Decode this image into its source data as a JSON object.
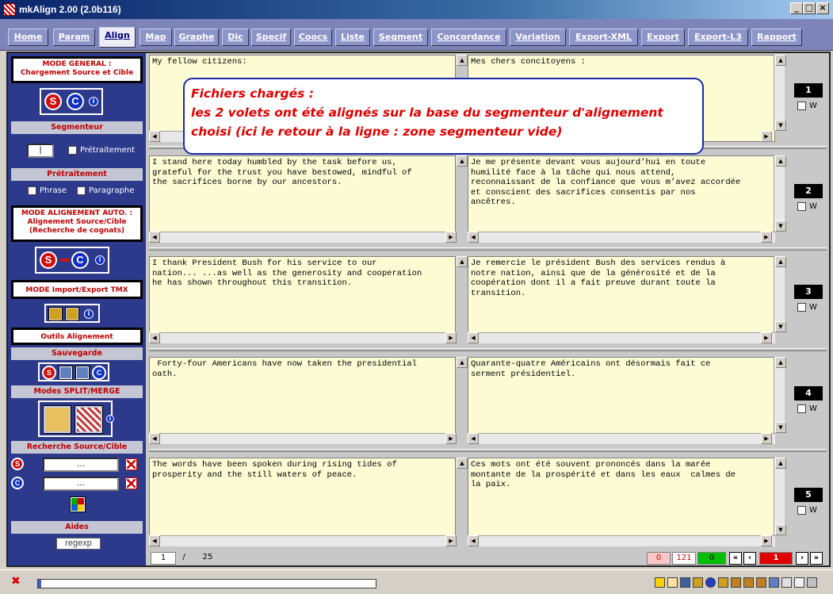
{
  "window": {
    "title": "mkAlign 2.00 (2.0b116)",
    "minimize": "_",
    "maximize": "□",
    "close": "×"
  },
  "tabs": [
    "Home",
    "Param",
    "Align",
    "Map",
    "Graphe",
    "Dic",
    "Specif",
    "Coocs",
    "Liste",
    "Segment",
    "Concordance",
    "Variation",
    "Export-XML",
    "Export",
    "Export-L3",
    "Rapport"
  ],
  "active_tab": "Align",
  "sidebar": {
    "mode_general": "MODE GENERAL :\nChargement Source et Cible",
    "segmenteur_label": "Segmenteur",
    "segmenteur_value": "|",
    "pretraitement_check": "Prétraitement",
    "pretraitement_label": "Prétraitement",
    "phrase_check": "Phrase",
    "paragraphe_check": "Paragraphe",
    "mode_alignement": "MODE ALIGNEMENT AUTO. :\nAlignement Source/Cible\n(Recherche de cognats)",
    "mode_tmx": "MODE Import/Export TMX",
    "outils": "Outils Alignement",
    "sauvegarde_label": "Sauvegarde",
    "modes_split_label": "Modes SPLIT/MERGE",
    "recherche_label": "Recherche Source/Cible",
    "search_source_value": "...",
    "search_target_value": "...",
    "aides_label": "Aides",
    "regexp_button": "regexp",
    "source_letter": "S",
    "cible_letter": "C",
    "info_letter": "i"
  },
  "callout": {
    "line1": "Fichiers chargés :",
    "line2": "les 2 volets ont été alignés sur la base du segmenteur d'alignement",
    "line3": "choisi (ici le retour à la ligne : zone segmenteur vide)"
  },
  "rows": [
    {
      "num": "1",
      "w_label": "W",
      "source": "My fellow citizens:",
      "target": "Mes chers concitoyens :"
    },
    {
      "num": "2",
      "w_label": "W",
      "source": "I stand here today humbled by the task before us,\ngrateful for the trust you have bestowed, mindful of\nthe sacrifices borne by our ancestors.",
      "target": "Je me présente devant vous aujourd’hui en toute\nhumilité face à la tâche qui nous attend,\nreconnaissant de la confiance que vous m’avez accordée\net conscient des sacrifices consentis par nos\nancêtres."
    },
    {
      "num": "3",
      "w_label": "W",
      "source": "I thank President Bush for his service to our\nnation... ...as well as the generosity and cooperation\nhe has shown throughout this transition.",
      "target": "Je remercie le président Bush des services rendus à\nnotre nation, ainsi que de la générosité et de la\ncoopération dont il a fait preuve durant toute la\ntransition."
    },
    {
      "num": "4",
      "w_label": "W",
      "source": " Forty-four Americans have now taken the presidential\noath.",
      "target": "Quarante-quatre Américains ont désormais fait ce\nserment présidentiel."
    },
    {
      "num": "5",
      "w_label": "W",
      "source": "The words have been spoken during rising tides of\nprosperity and the still waters of peace.",
      "target": "Ces mots ont été souvent prononcés dans la marée\nmontante de la prospérité et dans les eaux  calmes de\nla paix."
    }
  ],
  "pager": {
    "page": "1",
    "separator": "/",
    "total": "25",
    "count_pink": "0",
    "count_main": "121",
    "count_green": "0",
    "first": "«",
    "prev": "‹",
    "current": "1",
    "next": "›",
    "last": "»"
  },
  "status": {
    "error_icon": "✖",
    "progress": 0.01
  },
  "colors": {
    "accent": "#2d3a8c",
    "tab_bar": "#7d84b8",
    "callout_text": "#e00000",
    "pane_bg": "#fdfbd4"
  }
}
